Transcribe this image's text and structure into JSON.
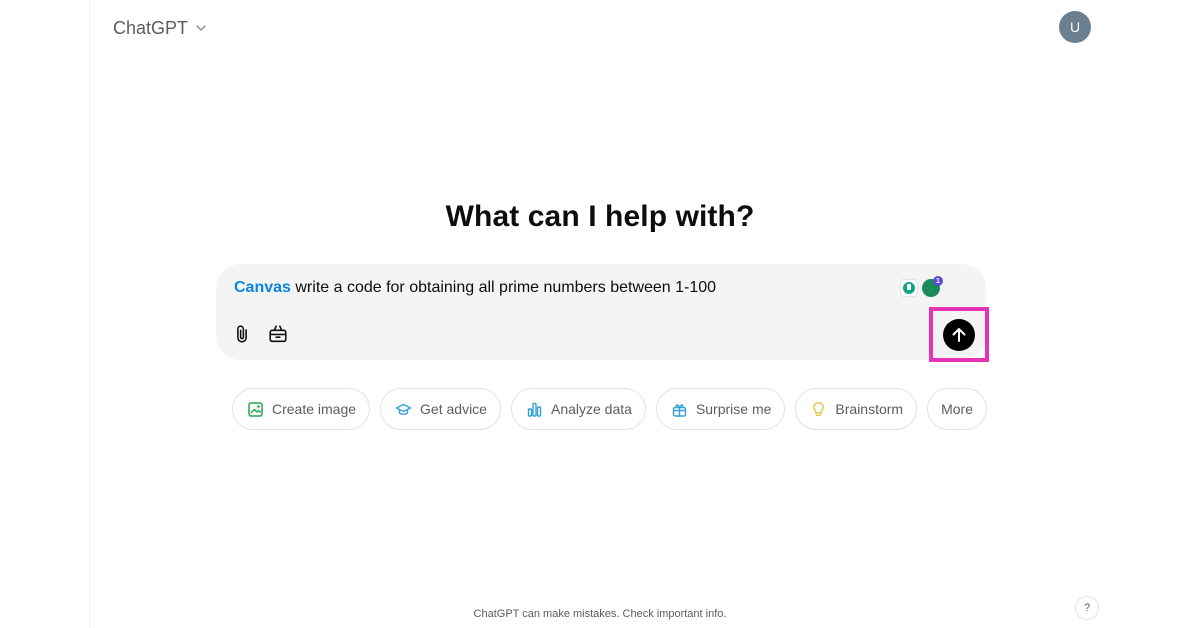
{
  "header": {
    "model_label": "ChatGPT",
    "model_icon": "chevron-down-icon",
    "avatar_initial": "U"
  },
  "main": {
    "headline": "What can I help with?"
  },
  "composer": {
    "tool_tag": "Canvas",
    "prompt_text": "write a code for obtaining all prime numbers between 1-100",
    "extension_badge_count": "1",
    "attach_icon": "paperclip-icon",
    "tools_icon": "toolbox-icon",
    "send_icon": "arrow-up-icon"
  },
  "suggestions": [
    {
      "label": "Create image",
      "icon": "image-icon",
      "color": "#2da44e"
    },
    {
      "label": "Get advice",
      "icon": "graduation-cap-icon",
      "color": "#35a0d6"
    },
    {
      "label": "Analyze data",
      "icon": "bar-chart-icon",
      "color": "#35a0d6"
    },
    {
      "label": "Surprise me",
      "icon": "gift-icon",
      "color": "#35a0d6"
    },
    {
      "label": "Brainstorm",
      "icon": "lightbulb-icon",
      "color": "#e2c541"
    },
    {
      "label": "More",
      "icon": "",
      "color": ""
    }
  ],
  "footer": {
    "disclaimer": "ChatGPT can make mistakes. Check important info.",
    "help_label": "?"
  },
  "colors": {
    "highlight_box": "#e633b5",
    "canvas_tag": "#0b85e0",
    "send_button": "#000000"
  }
}
